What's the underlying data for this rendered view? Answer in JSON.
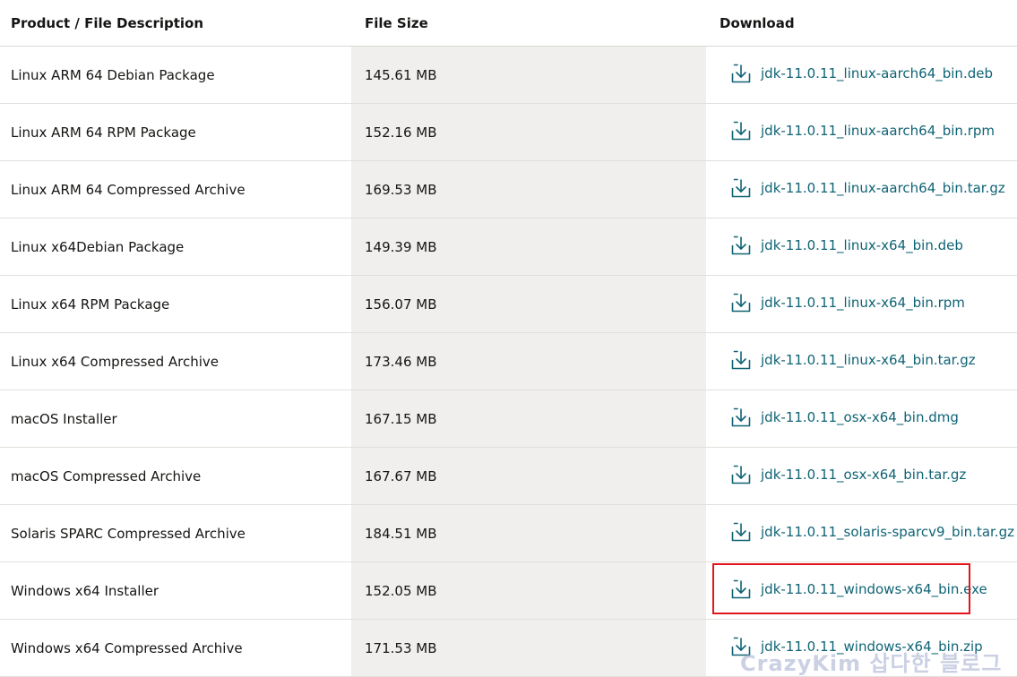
{
  "table": {
    "headers": {
      "description": "Product / File Description",
      "size": "File Size",
      "download": "Download"
    },
    "rows": [
      {
        "description": "Linux ARM 64 Debian Package",
        "size": "145.61 MB",
        "file": "jdk-11.0.11_linux-aarch64_bin.deb"
      },
      {
        "description": "Linux ARM 64 RPM Package",
        "size": "152.16 MB",
        "file": "jdk-11.0.11_linux-aarch64_bin.rpm"
      },
      {
        "description": "Linux ARM 64 Compressed Archive",
        "size": "169.53 MB",
        "file": "jdk-11.0.11_linux-aarch64_bin.tar.gz"
      },
      {
        "description": "Linux x64Debian Package",
        "size": "149.39 MB",
        "file": "jdk-11.0.11_linux-x64_bin.deb"
      },
      {
        "description": "Linux x64 RPM Package",
        "size": "156.07 MB",
        "file": "jdk-11.0.11_linux-x64_bin.rpm"
      },
      {
        "description": "Linux x64 Compressed Archive",
        "size": "173.46 MB",
        "file": "jdk-11.0.11_linux-x64_bin.tar.gz"
      },
      {
        "description": "macOS Installer",
        "size": "167.15 MB",
        "file": "jdk-11.0.11_osx-x64_bin.dmg"
      },
      {
        "description": "macOS Compressed Archive",
        "size": "167.67 MB",
        "file": "jdk-11.0.11_osx-x64_bin.tar.gz"
      },
      {
        "description": "Solaris SPARC Compressed Archive",
        "size": "184.51 MB",
        "file": "jdk-11.0.11_solaris-sparcv9_bin.tar.gz"
      },
      {
        "description": "Windows x64 Installer",
        "size": "152.05 MB",
        "file": "jdk-11.0.11_windows-x64_bin.exe"
      },
      {
        "description": "Windows x64 Compressed Archive",
        "size": "171.53 MB",
        "file": "jdk-11.0.11_windows-x64_bin.zip"
      }
    ]
  },
  "icons": {
    "download": "download-icon"
  },
  "watermark": "CrazyKim 삽다한 블로그",
  "colors": {
    "link": "#0f6375",
    "size_column_bg": "#f1efed",
    "highlight_border": "#e3141a",
    "row_border": "#e2e0dc"
  }
}
